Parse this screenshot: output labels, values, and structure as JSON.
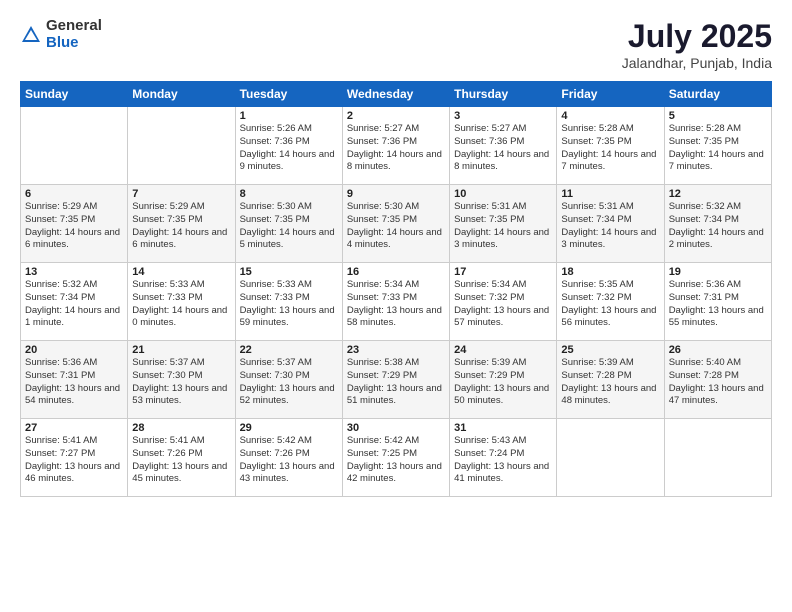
{
  "logo": {
    "general": "General",
    "blue": "Blue"
  },
  "title": "July 2025",
  "subtitle": "Jalandhar, Punjab, India",
  "headers": [
    "Sunday",
    "Monday",
    "Tuesday",
    "Wednesday",
    "Thursday",
    "Friday",
    "Saturday"
  ],
  "weeks": [
    [
      {
        "day": "",
        "info": ""
      },
      {
        "day": "",
        "info": ""
      },
      {
        "day": "1",
        "info": "Sunrise: 5:26 AM\nSunset: 7:36 PM\nDaylight: 14 hours and 9 minutes."
      },
      {
        "day": "2",
        "info": "Sunrise: 5:27 AM\nSunset: 7:36 PM\nDaylight: 14 hours and 8 minutes."
      },
      {
        "day": "3",
        "info": "Sunrise: 5:27 AM\nSunset: 7:36 PM\nDaylight: 14 hours and 8 minutes."
      },
      {
        "day": "4",
        "info": "Sunrise: 5:28 AM\nSunset: 7:35 PM\nDaylight: 14 hours and 7 minutes."
      },
      {
        "day": "5",
        "info": "Sunrise: 5:28 AM\nSunset: 7:35 PM\nDaylight: 14 hours and 7 minutes."
      }
    ],
    [
      {
        "day": "6",
        "info": "Sunrise: 5:29 AM\nSunset: 7:35 PM\nDaylight: 14 hours and 6 minutes."
      },
      {
        "day": "7",
        "info": "Sunrise: 5:29 AM\nSunset: 7:35 PM\nDaylight: 14 hours and 6 minutes."
      },
      {
        "day": "8",
        "info": "Sunrise: 5:30 AM\nSunset: 7:35 PM\nDaylight: 14 hours and 5 minutes."
      },
      {
        "day": "9",
        "info": "Sunrise: 5:30 AM\nSunset: 7:35 PM\nDaylight: 14 hours and 4 minutes."
      },
      {
        "day": "10",
        "info": "Sunrise: 5:31 AM\nSunset: 7:35 PM\nDaylight: 14 hours and 3 minutes."
      },
      {
        "day": "11",
        "info": "Sunrise: 5:31 AM\nSunset: 7:34 PM\nDaylight: 14 hours and 3 minutes."
      },
      {
        "day": "12",
        "info": "Sunrise: 5:32 AM\nSunset: 7:34 PM\nDaylight: 14 hours and 2 minutes."
      }
    ],
    [
      {
        "day": "13",
        "info": "Sunrise: 5:32 AM\nSunset: 7:34 PM\nDaylight: 14 hours and 1 minute."
      },
      {
        "day": "14",
        "info": "Sunrise: 5:33 AM\nSunset: 7:33 PM\nDaylight: 14 hours and 0 minutes."
      },
      {
        "day": "15",
        "info": "Sunrise: 5:33 AM\nSunset: 7:33 PM\nDaylight: 13 hours and 59 minutes."
      },
      {
        "day": "16",
        "info": "Sunrise: 5:34 AM\nSunset: 7:33 PM\nDaylight: 13 hours and 58 minutes."
      },
      {
        "day": "17",
        "info": "Sunrise: 5:34 AM\nSunset: 7:32 PM\nDaylight: 13 hours and 57 minutes."
      },
      {
        "day": "18",
        "info": "Sunrise: 5:35 AM\nSunset: 7:32 PM\nDaylight: 13 hours and 56 minutes."
      },
      {
        "day": "19",
        "info": "Sunrise: 5:36 AM\nSunset: 7:31 PM\nDaylight: 13 hours and 55 minutes."
      }
    ],
    [
      {
        "day": "20",
        "info": "Sunrise: 5:36 AM\nSunset: 7:31 PM\nDaylight: 13 hours and 54 minutes."
      },
      {
        "day": "21",
        "info": "Sunrise: 5:37 AM\nSunset: 7:30 PM\nDaylight: 13 hours and 53 minutes."
      },
      {
        "day": "22",
        "info": "Sunrise: 5:37 AM\nSunset: 7:30 PM\nDaylight: 13 hours and 52 minutes."
      },
      {
        "day": "23",
        "info": "Sunrise: 5:38 AM\nSunset: 7:29 PM\nDaylight: 13 hours and 51 minutes."
      },
      {
        "day": "24",
        "info": "Sunrise: 5:39 AM\nSunset: 7:29 PM\nDaylight: 13 hours and 50 minutes."
      },
      {
        "day": "25",
        "info": "Sunrise: 5:39 AM\nSunset: 7:28 PM\nDaylight: 13 hours and 48 minutes."
      },
      {
        "day": "26",
        "info": "Sunrise: 5:40 AM\nSunset: 7:28 PM\nDaylight: 13 hours and 47 minutes."
      }
    ],
    [
      {
        "day": "27",
        "info": "Sunrise: 5:41 AM\nSunset: 7:27 PM\nDaylight: 13 hours and 46 minutes."
      },
      {
        "day": "28",
        "info": "Sunrise: 5:41 AM\nSunset: 7:26 PM\nDaylight: 13 hours and 45 minutes."
      },
      {
        "day": "29",
        "info": "Sunrise: 5:42 AM\nSunset: 7:26 PM\nDaylight: 13 hours and 43 minutes."
      },
      {
        "day": "30",
        "info": "Sunrise: 5:42 AM\nSunset: 7:25 PM\nDaylight: 13 hours and 42 minutes."
      },
      {
        "day": "31",
        "info": "Sunrise: 5:43 AM\nSunset: 7:24 PM\nDaylight: 13 hours and 41 minutes."
      },
      {
        "day": "",
        "info": ""
      },
      {
        "day": "",
        "info": ""
      }
    ]
  ]
}
